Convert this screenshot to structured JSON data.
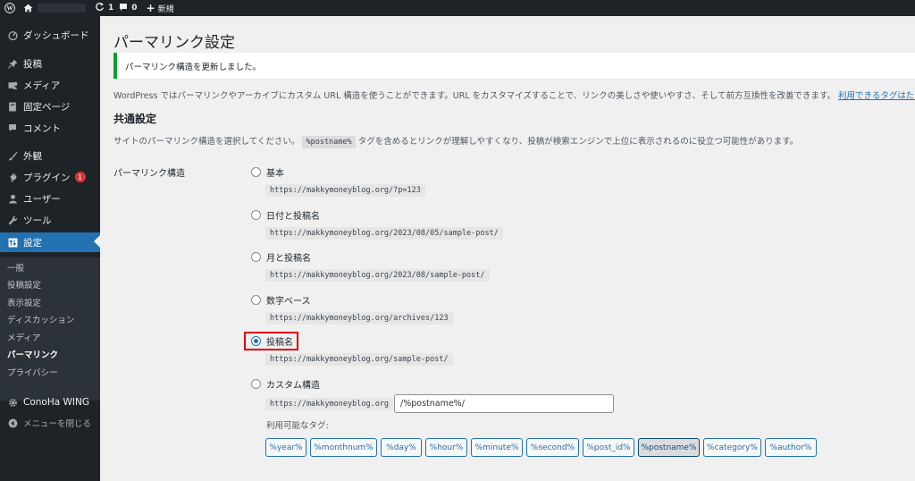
{
  "adminbar": {
    "updates_count": "1",
    "comments_count": "0",
    "new_label": "新規"
  },
  "sidebar": {
    "items": [
      {
        "label": "ダッシュボード",
        "icon": "dashboard-icon"
      },
      {
        "label": "投稿",
        "icon": "pin-icon"
      },
      {
        "label": "メディア",
        "icon": "media-icon"
      },
      {
        "label": "固定ページ",
        "icon": "page-icon"
      },
      {
        "label": "コメント",
        "icon": "comment-icon"
      },
      {
        "label": "外観",
        "icon": "brush-icon"
      },
      {
        "label": "プラグイン",
        "icon": "plugin-icon",
        "badge": "1"
      },
      {
        "label": "ユーザー",
        "icon": "user-icon"
      },
      {
        "label": "ツール",
        "icon": "wrench-icon"
      },
      {
        "label": "設定",
        "icon": "settings-icon"
      }
    ],
    "submenu": [
      "一般",
      "投稿設定",
      "表示設定",
      "ディスカッション",
      "メディア",
      "パーマリンク",
      "プライバシー"
    ],
    "conoha_label": "ConoHa WING",
    "collapse_label": "メニューを閉じる"
  },
  "main": {
    "title": "パーマリンク設定",
    "notice": "パーマリンク構造を更新しました。",
    "intro_text": "WordPress ではパーマリンクやアーカイブにカスタム URL 構造を使うことができます。URL をカスタマイズすることで、リンクの美しさや使いやすさ、そして前方互換性を改善できます。",
    "intro_link": "利用できるタグはたくさんあり",
    "section_title": "共通設定",
    "section_desc_before": "サイトのパーマリンク構造を選択してください。",
    "section_desc_code": "%postname%",
    "section_desc_after": "タグを含めるとリンクが理解しやすくなり、投稿が検索エンジンで上位に表示されるのに役立つ可能性があります。",
    "structure_label": "パーマリンク構造",
    "options": [
      {
        "label": "基本",
        "url": "https://makkymoneyblog.org/?p=123",
        "checked": false
      },
      {
        "label": "日付と投稿名",
        "url": "https://makkymoneyblog.org/2023/08/05/sample-post/",
        "checked": false
      },
      {
        "label": "月と投稿名",
        "url": "https://makkymoneyblog.org/2023/08/sample-post/",
        "checked": false
      },
      {
        "label": "数字ベース",
        "url": "https://makkymoneyblog.org/archives/123",
        "checked": false
      },
      {
        "label": "投稿名",
        "url": "https://makkymoneyblog.org/sample-post/",
        "checked": true
      },
      {
        "label": "カスタム構造",
        "checked": false
      }
    ],
    "custom_prefix": "https://makkymoneyblog.org",
    "custom_value": "/%postname%/",
    "available_tags_label": "利用可能なタグ:",
    "tags": [
      "%year%",
      "%monthnum%",
      "%day%",
      "%hour%",
      "%minute%",
      "%second%",
      "%post_id%",
      "%postname%",
      "%category%",
      "%author%"
    ],
    "active_tag": "%postname%"
  }
}
